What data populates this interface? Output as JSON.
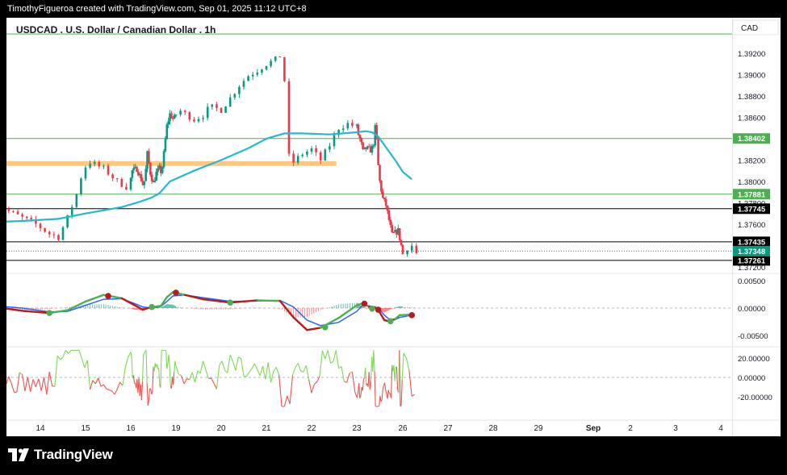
{
  "header": {
    "attribution": "TimothyFigueroa created with TradingView.com, Sep 01, 2025 11:12 UTC+8"
  },
  "footer": {
    "logo_text": "TradingView",
    "logo_icon": "tradingview-logo-icon"
  },
  "colors": {
    "up": "#089981",
    "down": "#f23645",
    "ma": "#26b8cf",
    "support_zone": "#ffc880",
    "hline_green": "#4caf50",
    "hline_black": "#000000",
    "macd_fast_up": "#4caf50",
    "macd_fast_down": "#b71c1c",
    "macd_slow": "#2962ff",
    "rsi_up": "#7ed957",
    "rsi_down": "#ef5350"
  },
  "chart_data": [
    {
      "type": "candlestick",
      "title": "USDCAD . U.S. Dollar / Canadian Dollar . 1h",
      "currency": "CAD",
      "x_tick_labels": [
        "14",
        "15",
        "16",
        "19",
        "20",
        "21",
        "22",
        "23",
        "26",
        "27",
        "28",
        "29",
        "Sep",
        "2",
        "3",
        "4"
      ],
      "x_tick_days": [
        14,
        15,
        16,
        19,
        20,
        21,
        22,
        23,
        26,
        27,
        28,
        29,
        31,
        32,
        33,
        34
      ],
      "y_tick_labels": [
        "1.39200",
        "1.39000",
        "1.38800",
        "1.38600",
        "1.38400",
        "1.38200",
        "1.38000",
        "1.37800",
        "1.37600",
        "1.37400",
        "1.37200"
      ],
      "ylim": [
        1.3719,
        1.3935
      ],
      "price_path": [
        [
          13.0,
          1.3781
        ],
        [
          13.3,
          1.3772
        ],
        [
          13.6,
          1.3766
        ],
        [
          13.9,
          1.376
        ],
        [
          14.2,
          1.3751
        ],
        [
          14.4,
          1.3748
        ],
        [
          14.6,
          1.3766
        ],
        [
          14.8,
          1.3788
        ],
        [
          14.95,
          1.3812
        ],
        [
          15.1,
          1.3818
        ],
        [
          15.4,
          1.3812
        ],
        [
          15.7,
          1.38
        ],
        [
          15.9,
          1.3795
        ],
        [
          16.1,
          1.381
        ],
        [
          16.4,
          1.3812
        ],
        [
          16.7,
          1.3802
        ],
        [
          16.85,
          1.3795
        ],
        [
          17.0,
          1.3811
        ],
        [
          17.1,
          1.3826
        ],
        [
          17.3,
          1.3808
        ],
        [
          17.5,
          1.3798
        ],
        [
          17.7,
          1.3808
        ],
        [
          17.9,
          1.3812
        ],
        [
          18.05,
          1.3808
        ],
        [
          18.2,
          1.3826
        ],
        [
          18.4,
          1.3852
        ],
        [
          18.6,
          1.3863
        ],
        [
          18.85,
          1.3858
        ],
        [
          19.1,
          1.3866
        ],
        [
          19.4,
          1.3858
        ],
        [
          19.6,
          1.3862
        ],
        [
          19.75,
          1.387
        ],
        [
          20.0,
          1.3867
        ],
        [
          20.2,
          1.3878
        ],
        [
          20.4,
          1.389
        ],
        [
          20.6,
          1.3899
        ],
        [
          20.8,
          1.3904
        ],
        [
          21.0,
          1.391
        ],
        [
          21.2,
          1.3914
        ],
        [
          21.38,
          1.392
        ],
        [
          21.45,
          1.383
        ],
        [
          21.6,
          1.3818
        ],
        [
          21.8,
          1.3826
        ],
        [
          22.0,
          1.383
        ],
        [
          22.2,
          1.382
        ],
        [
          22.4,
          1.3834
        ],
        [
          22.6,
          1.385
        ],
        [
          22.8,
          1.3854
        ],
        [
          23.0,
          1.3851
        ],
        [
          23.1,
          1.3844
        ],
        [
          23.25,
          1.3838
        ],
        [
          23.4,
          1.3828
        ],
        [
          23.6,
          1.3831
        ],
        [
          23.8,
          1.383
        ],
        [
          23.95,
          1.3829
        ],
        [
          24.1,
          1.3836
        ],
        [
          24.2,
          1.385
        ],
        [
          24.3,
          1.384
        ],
        [
          24.35,
          1.3822
        ],
        [
          24.5,
          1.38
        ],
        [
          24.7,
          1.3784
        ],
        [
          24.9,
          1.3778
        ],
        [
          25.1,
          1.3764
        ],
        [
          25.3,
          1.375
        ],
        [
          25.5,
          1.3752
        ],
        [
          25.7,
          1.3754
        ],
        [
          25.8,
          1.3747
        ],
        [
          25.85,
          1.3775
        ],
        [
          25.9,
          1.374
        ],
        [
          26.0,
          1.3732
        ],
        [
          26.1,
          1.3738
        ],
        [
          26.2,
          1.374
        ],
        [
          26.3,
          1.3733
        ]
      ],
      "ma_path": [
        [
          13.0,
          1.3762
        ],
        [
          13.6,
          1.3763
        ],
        [
          14.4,
          1.3765
        ],
        [
          15.0,
          1.377
        ],
        [
          15.8,
          1.3776
        ],
        [
          16.6,
          1.3781
        ],
        [
          17.4,
          1.3785
        ],
        [
          17.9,
          1.3789
        ],
        [
          18.6,
          1.38
        ],
        [
          19.4,
          1.381
        ],
        [
          20.0,
          1.382
        ],
        [
          20.6,
          1.3831
        ],
        [
          21.0,
          1.384
        ],
        [
          21.4,
          1.3845
        ],
        [
          21.8,
          1.3845
        ],
        [
          22.4,
          1.3844
        ],
        [
          23.0,
          1.3846
        ],
        [
          23.6,
          1.3847
        ],
        [
          24.0,
          1.3846
        ],
        [
          24.4,
          1.3842
        ],
        [
          24.8,
          1.3834
        ],
        [
          25.2,
          1.3826
        ],
        [
          25.6,
          1.3818
        ],
        [
          26.0,
          1.3809
        ],
        [
          26.2,
          1.3802
        ]
      ],
      "support_zone": {
        "x_start": 13.0,
        "x_end": 22.55,
        "y_low": 1.38145,
        "y_high": 1.3819
      },
      "horizontal_lines": [
        {
          "price": 1.38402,
          "label": "1.38402",
          "style": "green"
        },
        {
          "price": 1.37881,
          "label": "1.37881",
          "style": "green"
        },
        {
          "price": 1.37745,
          "label": "1.37745",
          "style": "black"
        },
        {
          "price": 1.37435,
          "label": "1.37435",
          "style": "black"
        },
        {
          "price": 1.37261,
          "label": "1.37261",
          "style": "black"
        },
        {
          "price": 1.3938,
          "label": "",
          "style": "green"
        }
      ],
      "last_price": {
        "price": 1.37348,
        "label": "1.37348"
      }
    },
    {
      "type": "macd",
      "y_tick_labels": [
        "0.00500",
        "0.00000",
        "-0.00500"
      ],
      "ylim": [
        -0.0063,
        0.0044
      ],
      "fast_line": [
        [
          13.0,
          0.0002
        ],
        [
          13.6,
          -0.0005
        ],
        [
          14.2,
          -0.0009
        ],
        [
          14.6,
          -0.0004
        ],
        [
          15.0,
          0.0012
        ],
        [
          15.4,
          0.0024
        ],
        [
          15.8,
          0.0018
        ],
        [
          16.2,
          0.0006
        ],
        [
          16.8,
          -0.0003
        ],
        [
          17.4,
          0.0002
        ],
        [
          18.0,
          0.0004
        ],
        [
          18.4,
          0.002
        ],
        [
          18.8,
          0.0029
        ],
        [
          19.2,
          0.0024
        ],
        [
          19.6,
          0.0016
        ],
        [
          20.2,
          0.001
        ],
        [
          20.8,
          0.0014
        ],
        [
          21.3,
          0.0013
        ],
        [
          21.6,
          -0.0017
        ],
        [
          21.9,
          -0.004
        ],
        [
          22.2,
          -0.0036
        ],
        [
          22.6,
          -0.0018
        ],
        [
          23.0,
          0.0005
        ],
        [
          23.4,
          0.0009
        ],
        [
          23.8,
          0.0002
        ],
        [
          24.2,
          0.0001
        ],
        [
          24.5,
          -0.0008
        ],
        [
          24.8,
          -0.0022
        ],
        [
          25.1,
          -0.0024
        ],
        [
          25.5,
          -0.002
        ],
        [
          25.8,
          -0.0013
        ],
        [
          26.2,
          -0.0012
        ]
      ],
      "slow_line": [
        [
          13.0,
          0.0004
        ],
        [
          13.6,
          0.0
        ],
        [
          14.2,
          -0.0007
        ],
        [
          14.6,
          -0.0006
        ],
        [
          15.0,
          0.0005
        ],
        [
          15.4,
          0.0016
        ],
        [
          15.8,
          0.0017
        ],
        [
          16.2,
          0.0009
        ],
        [
          16.8,
          0.0002
        ],
        [
          17.4,
          0.0
        ],
        [
          18.0,
          0.0003
        ],
        [
          18.4,
          0.0012
        ],
        [
          18.8,
          0.0022
        ],
        [
          19.2,
          0.0024
        ],
        [
          19.6,
          0.0019
        ],
        [
          20.2,
          0.0012
        ],
        [
          20.8,
          0.0013
        ],
        [
          21.3,
          0.0014
        ],
        [
          21.6,
          0.0002
        ],
        [
          21.9,
          -0.0022
        ],
        [
          22.2,
          -0.0032
        ],
        [
          22.6,
          -0.0026
        ],
        [
          23.0,
          -0.0006
        ],
        [
          23.4,
          0.0006
        ],
        [
          23.8,
          0.0004
        ],
        [
          24.2,
          0.0002
        ],
        [
          24.5,
          -0.0003
        ],
        [
          24.8,
          -0.0013
        ],
        [
          25.1,
          -0.002
        ],
        [
          25.5,
          -0.0021
        ],
        [
          25.8,
          -0.0017
        ],
        [
          26.2,
          -0.0013
        ]
      ],
      "cross_markers": [
        {
          "x": 14.2,
          "value": -0.0009,
          "kind": "bullish"
        },
        {
          "x": 15.5,
          "value": 0.0022,
          "kind": "bearish"
        },
        {
          "x": 17.4,
          "value": 0.0002,
          "kind": "bullish"
        },
        {
          "x": 19.0,
          "value": 0.0028,
          "kind": "bearish"
        },
        {
          "x": 20.2,
          "value": 0.001,
          "kind": "bullish"
        },
        {
          "x": 22.3,
          "value": -0.0035,
          "kind": "bullish"
        },
        {
          "x": 23.5,
          "value": 0.0008,
          "kind": "bearish"
        },
        {
          "x": 24.0,
          "value": -0.0001,
          "kind": "bullish"
        },
        {
          "x": 24.4,
          "value": -0.0003,
          "kind": "bearish"
        },
        {
          "x": 25.2,
          "value": -0.0024,
          "kind": "bullish"
        },
        {
          "x": 26.2,
          "value": -0.0013,
          "kind": "bearish"
        }
      ]
    },
    {
      "type": "oscillator",
      "y_tick_labels": [
        "20.00000",
        "0.00000",
        "-20.00000"
      ],
      "ylim": [
        -33,
        30
      ]
    }
  ]
}
